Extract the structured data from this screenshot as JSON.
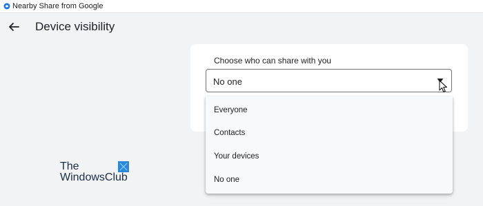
{
  "window": {
    "title": "Nearby Share from Google"
  },
  "header": {
    "title": "Device visibility"
  },
  "visibility": {
    "label": "Choose who can share with you",
    "selected": "No one",
    "options": [
      "Everyone",
      "Contacts",
      "Your devices",
      "No one"
    ]
  },
  "watermark": {
    "line1": "The",
    "line2": "WindowsClub"
  },
  "colors": {
    "background": "#f1f3f4",
    "card": "#ffffff",
    "watermark_blue": "#2b88d8"
  },
  "icons": {
    "app": "nearby-share-icon",
    "back": "arrow-left-icon",
    "dropdown": "caret-down-icon",
    "cursor": "mouse-pointer-icon",
    "logo": "windows-logo-icon"
  }
}
